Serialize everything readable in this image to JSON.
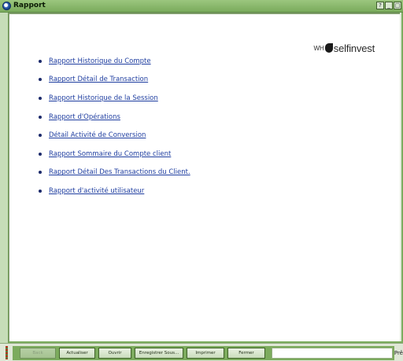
{
  "window": {
    "title": "Rapport",
    "controls": [
      "?",
      "_",
      "□"
    ]
  },
  "logo": {
    "prefix": "WH",
    "name": "selfinvest"
  },
  "reports": [
    "Rapport Historique du Compte",
    "Rapport Détail de Transaction",
    "Rapport Historique de la Session",
    "Rapport d'Opérations",
    "Détail Activité de Conversion",
    "Rapport Sommaire du Compte client",
    "Rapport Détail Des Transactions du Client.",
    "Rapport d'activité utilisateur"
  ],
  "toolbar": {
    "back_label": "Back",
    "refresh_label": "Actualiser",
    "open_label": "Ouvrir",
    "save_as_label": "Enregistrer Sous...",
    "print_label": "Imprimer",
    "close_label": "Fermer",
    "status_text": "Prê"
  },
  "colors": {
    "frame": "#7cad5f",
    "link": "#1f3ea0",
    "content_bg": "#ffffff"
  }
}
